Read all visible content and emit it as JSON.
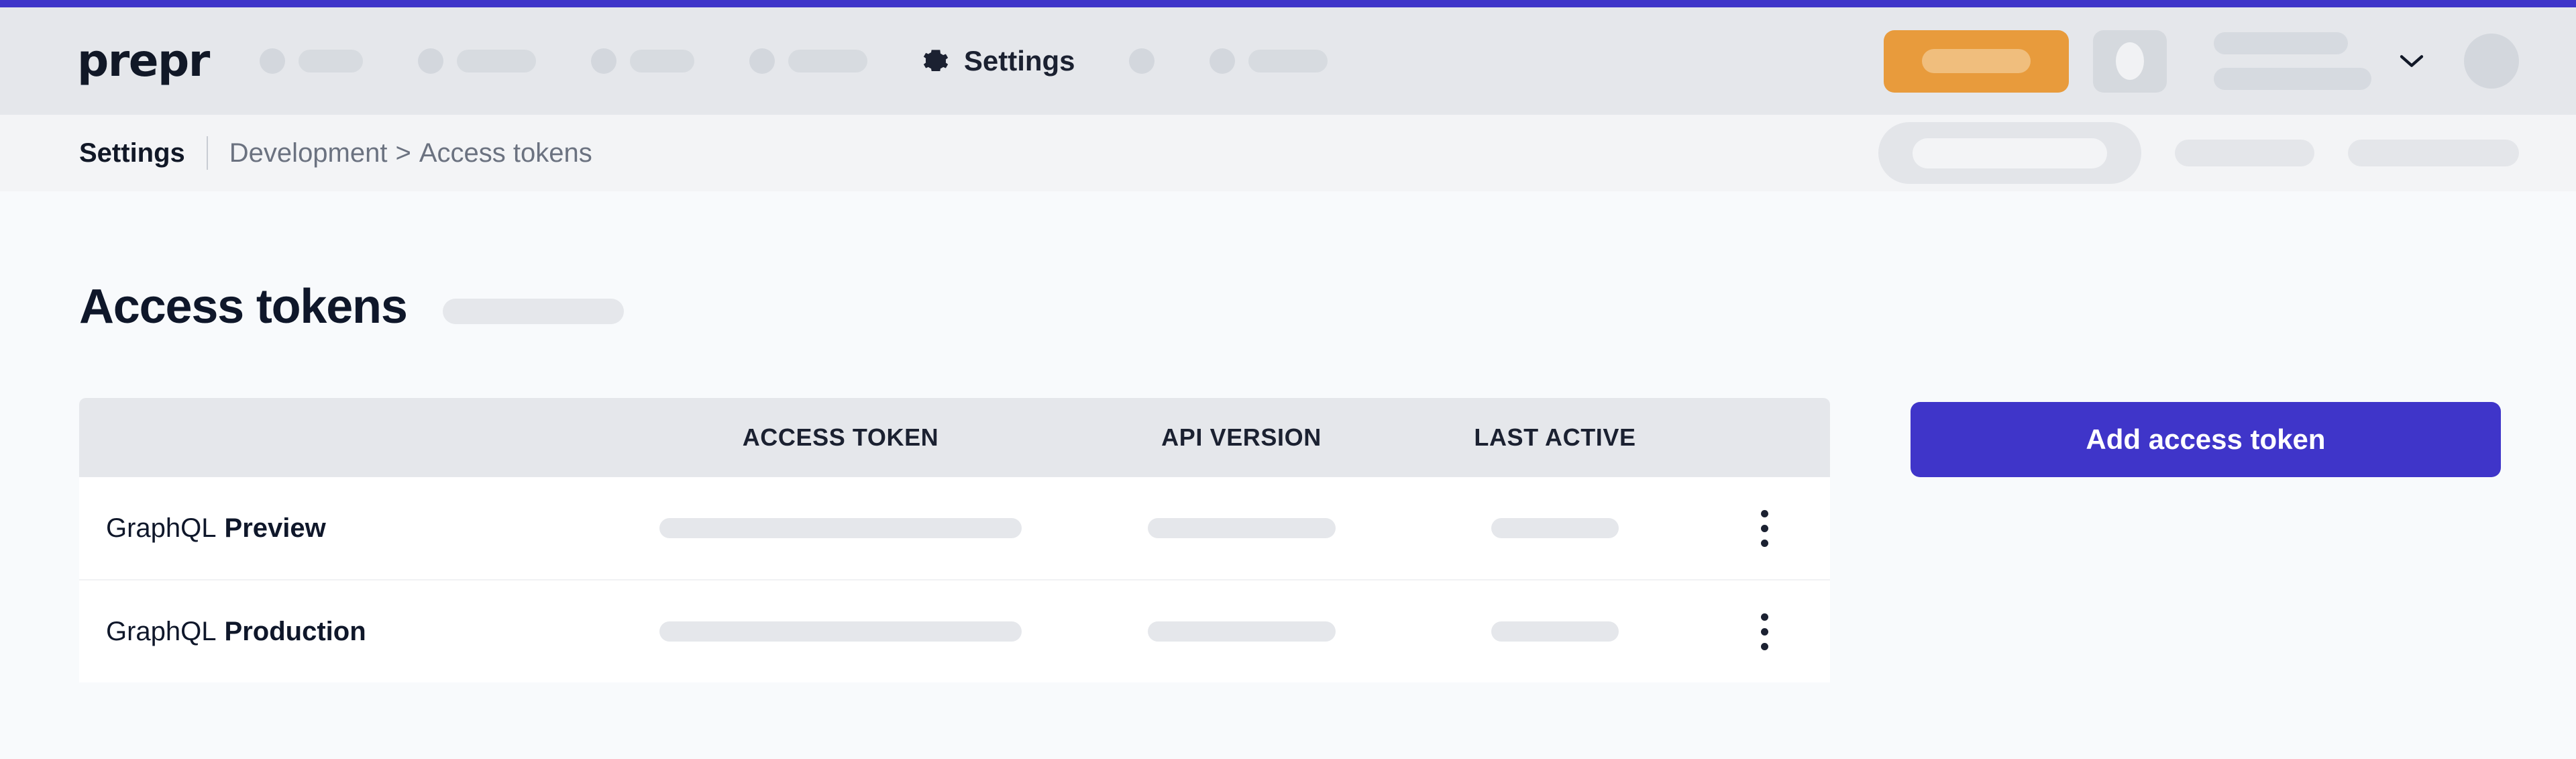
{
  "theme": {
    "accent_purple": "#3F35C9",
    "accent_orange": "#E89B3C",
    "header_bg": "#E5E7EB",
    "subheader_bg": "#F3F4F6",
    "page_bg": "#F8FAFC",
    "skeleton_gray": "#E5E7EB"
  },
  "header": {
    "brand": "prepr",
    "nav_active": {
      "label": "Settings",
      "icon": "gear-icon"
    },
    "chevron_icon": "chevron-down-icon",
    "nav_skeleton_count": 4,
    "nav_skeleton_widths": [
      96,
      118,
      96,
      118
    ]
  },
  "subheader": {
    "title": "Settings",
    "breadcrumb_parent": "Development",
    "breadcrumb_separator": ">",
    "breadcrumb_current": "Access tokens"
  },
  "main": {
    "page_title": "Access tokens",
    "add_button_label": "Add access token",
    "table": {
      "columns": [
        "",
        "ACCESS TOKEN",
        "API VERSION",
        "LAST ACTIVE",
        ""
      ],
      "rows": [
        {
          "service": "GraphQL",
          "environment": "Preview",
          "menu_icon": "kebab-menu-icon"
        },
        {
          "service": "GraphQL",
          "environment": "Production",
          "menu_icon": "kebab-menu-icon"
        }
      ]
    }
  }
}
